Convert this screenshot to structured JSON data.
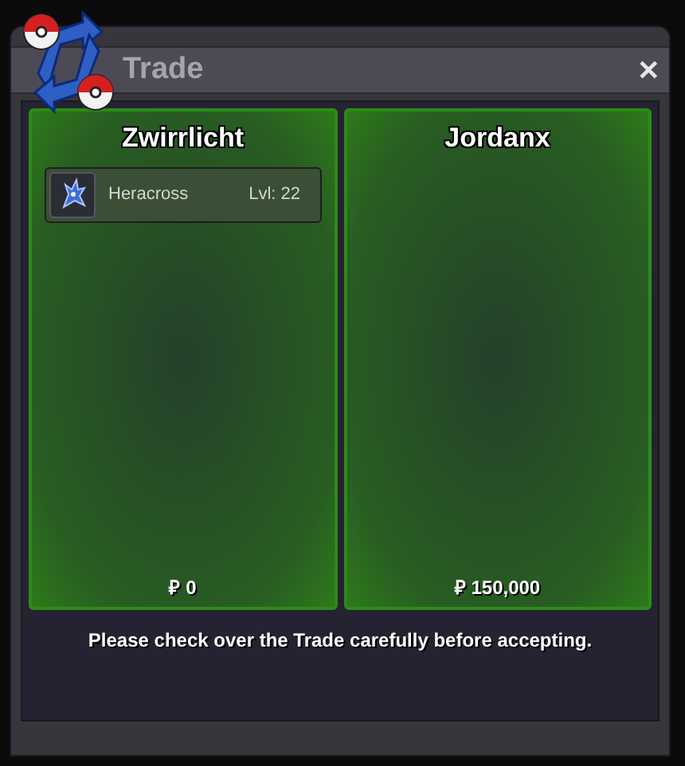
{
  "window": {
    "title": "Trade",
    "close": "✕"
  },
  "offers": [
    {
      "player": "Zwirrlicht",
      "items": [
        {
          "name": "Heracross",
          "level": "Lvl: 22"
        }
      ],
      "money": "₽ 0"
    },
    {
      "player": "Jordanx",
      "money": "₽ 150,000"
    }
  ],
  "message": "Please check over the Trade carefully before accepting."
}
